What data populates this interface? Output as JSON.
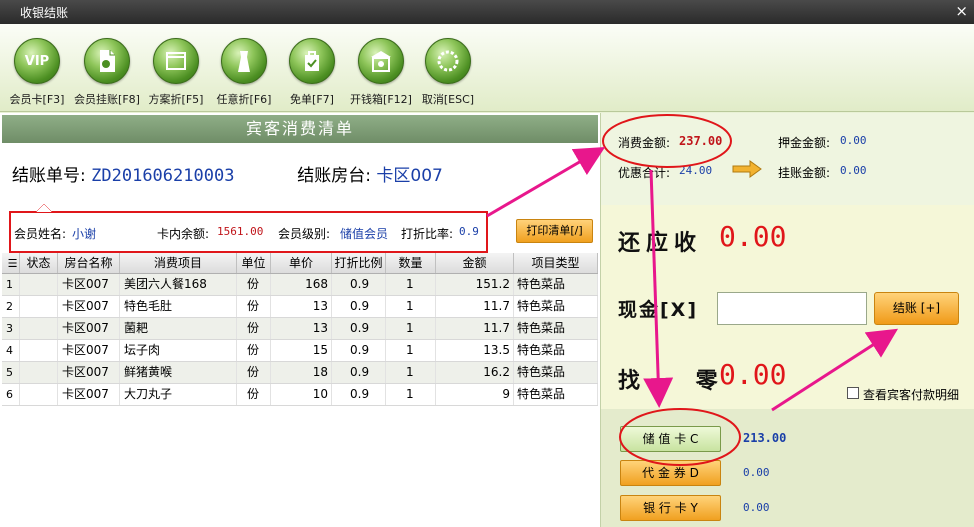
{
  "window": {
    "title": "收银结账",
    "close_glyph": "×"
  },
  "toolbar": {
    "buttons": [
      {
        "label": "会员卡[F3]",
        "icon_text": "VIP",
        "icon": "vip-icon"
      },
      {
        "label": "会员挂账[F8]",
        "icon_text": "",
        "icon": "document-icon"
      },
      {
        "label": "方案折[F5]",
        "icon_text": "",
        "icon": "window-icon"
      },
      {
        "label": "任意折[F6]",
        "icon_text": "",
        "icon": "shirt-icon"
      },
      {
        "label": "免单[F7]",
        "icon_text": "",
        "icon": "bag-check-icon"
      },
      {
        "label": "开钱箱[F12]",
        "icon_text": "",
        "icon": "cashbox-icon"
      },
      {
        "label": "取消[ESC]",
        "icon_text": "",
        "icon": "cancel-icon"
      }
    ]
  },
  "guest_list": {
    "header": "宾客消费清单",
    "bill_no_label": "结账单号:",
    "bill_no": "ZD201606210003",
    "room_label": "结账房台:",
    "room": "卡区007",
    "member": {
      "name_label": "会员姓名:",
      "name": "小谢",
      "balance_label": "卡内余额:",
      "balance": "1561.00",
      "level_label": "会员级别:",
      "level": "储值会员",
      "discount_label": "打折比率:",
      "discount": "0.9"
    },
    "print_button": "打印清单[/]",
    "columns": [
      "状态",
      "房台名称",
      "消费项目",
      "单位",
      "单价",
      "打折比例",
      "数量",
      "金额",
      "项目类型"
    ],
    "rows": [
      {
        "idx": "1",
        "status": "",
        "room": "卡区007",
        "item": "美团六人餐168",
        "unit": "份",
        "price": "168",
        "rate": "0.9",
        "qty": "1",
        "amount": "151.2",
        "type": "特色菜品"
      },
      {
        "idx": "2",
        "status": "",
        "room": "卡区007",
        "item": "特色毛肚",
        "unit": "份",
        "price": "13",
        "rate": "0.9",
        "qty": "1",
        "amount": "11.7",
        "type": "特色菜品"
      },
      {
        "idx": "3",
        "status": "",
        "room": "卡区007",
        "item": "菌耙",
        "unit": "份",
        "price": "13",
        "rate": "0.9",
        "qty": "1",
        "amount": "11.7",
        "type": "特色菜品"
      },
      {
        "idx": "4",
        "status": "",
        "room": "卡区007",
        "item": "坛子肉",
        "unit": "份",
        "price": "15",
        "rate": "0.9",
        "qty": "1",
        "amount": "13.5",
        "type": "特色菜品"
      },
      {
        "idx": "5",
        "status": "",
        "room": "卡区007",
        "item": "鲜猪黄喉",
        "unit": "份",
        "price": "18",
        "rate": "0.9",
        "qty": "1",
        "amount": "16.2",
        "type": "特色菜品"
      },
      {
        "idx": "6",
        "status": "",
        "room": "卡区007",
        "item": "大刀丸子",
        "unit": "份",
        "price": "10",
        "rate": "0.9",
        "qty": "1",
        "amount": "9",
        "type": "特色菜品"
      }
    ]
  },
  "summary": {
    "consume_label": "消费金额:",
    "consume": "237.00",
    "deposit_label": "押金金额:",
    "deposit": "0.00",
    "discount_total_label": "优惠合计:",
    "discount_total": "24.00",
    "credit_label": "挂账金额:",
    "credit": "0.00"
  },
  "payment": {
    "due_label": "还应收",
    "due": "0.00",
    "cash_label": "现金[X]",
    "cash_value": "",
    "checkout_button": "结账 [+]",
    "change_label": "找 零",
    "change": "0.00",
    "detail_checkbox_label": "查看宾客付款明细",
    "methods": [
      {
        "label": "储 值 卡 C",
        "value": "213.00",
        "selected": true
      },
      {
        "label": "代 金 券 D",
        "value": "0.00",
        "selected": false
      },
      {
        "label": "银 行 卡 Y",
        "value": "0.00",
        "selected": false
      }
    ]
  },
  "colors": {
    "accent_red": "#e0161a",
    "value_blue": "#1a3fa8",
    "annotation": "#e8178c"
  }
}
